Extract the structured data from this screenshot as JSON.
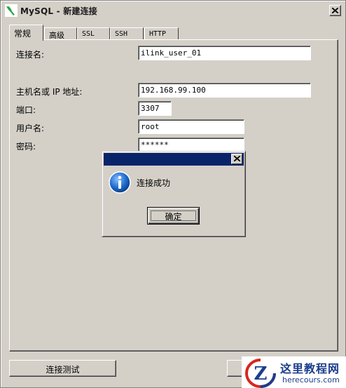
{
  "window": {
    "title": "MySQL - 新建连接"
  },
  "tabs": [
    {
      "label": "常规",
      "active": true
    },
    {
      "label": "高级",
      "active": false
    },
    {
      "label": "SSL",
      "active": false
    },
    {
      "label": "SSH",
      "active": false
    },
    {
      "label": "HTTP",
      "active": false
    }
  ],
  "form": {
    "connection_name_label": "连接名:",
    "connection_name_value": "ilink_user_01",
    "host_label": "主机名或 IP 地址:",
    "host_value": "192.168.99.100",
    "port_label": "端口:",
    "port_value": "3307",
    "username_label": "用户名:",
    "username_value": "root",
    "password_label": "密码:",
    "password_value": "******"
  },
  "buttons": {
    "test_connection": "连接测试"
  },
  "dialog": {
    "message": "连接成功",
    "ok_label": "确定"
  },
  "watermark": {
    "title": "这里教程网",
    "url": "herecours.com",
    "logo_letter": "Z"
  },
  "colors": {
    "window_bg": "#d4d0c8",
    "dialog_title_bg": "#0a246a",
    "info_blue": "#1f6fd0",
    "brand_green": "#2ea34a",
    "watermark_blue": "#1c3d8c",
    "watermark_red": "#d7261e"
  },
  "icons": {
    "app": "mysql-dolphin-icon",
    "close": "close-icon",
    "info": "info-icon"
  }
}
